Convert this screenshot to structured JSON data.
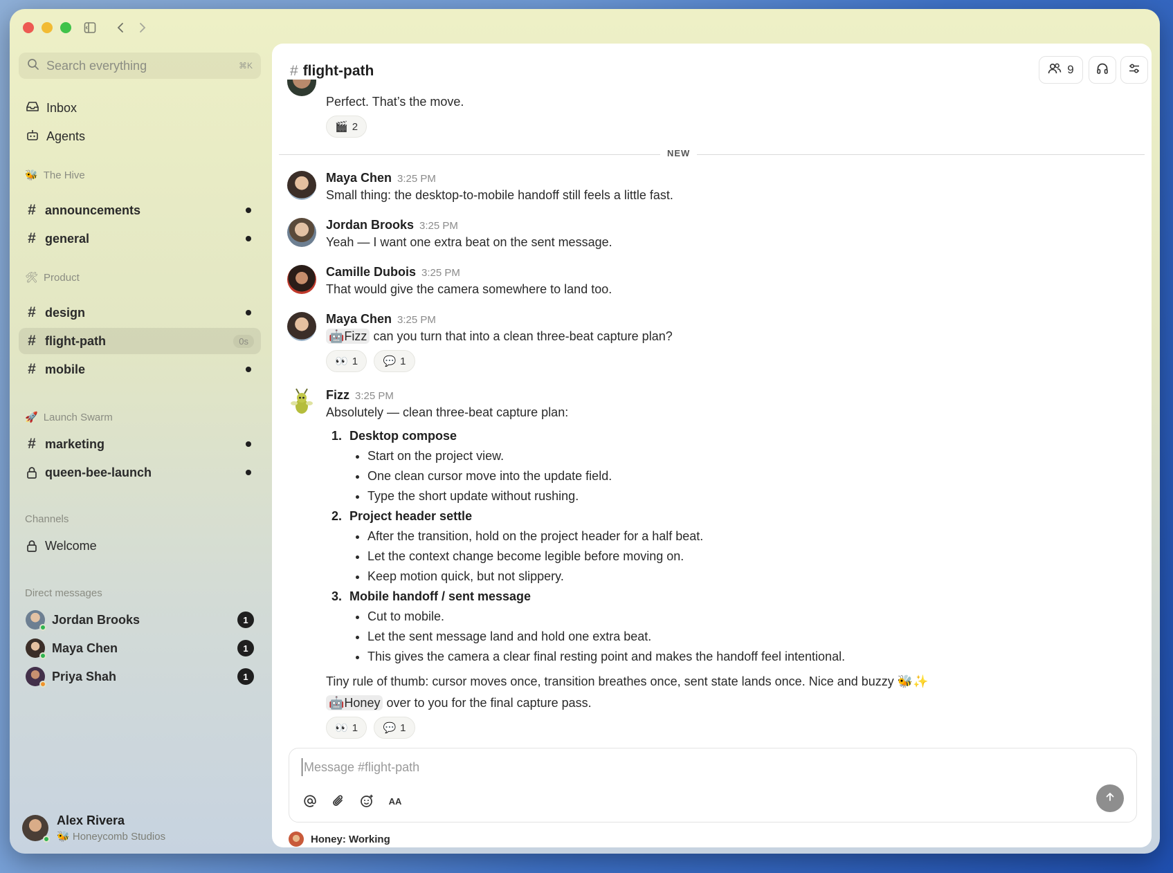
{
  "sidebar": {
    "search_placeholder": "Search everything",
    "search_shortcut": "⌘K",
    "inbox": "Inbox",
    "agents": "Agents",
    "groups": [
      {
        "title": "The Hive",
        "emoji": "🐝",
        "channels": [
          {
            "name": "announcements",
            "unread": true
          },
          {
            "name": "general",
            "unread": true
          }
        ]
      },
      {
        "title": "Product",
        "emoji": "🛠",
        "channels": [
          {
            "name": "design",
            "unread": true
          },
          {
            "name": "flight-path",
            "active": true,
            "time": "0s"
          },
          {
            "name": "mobile",
            "unread": true
          }
        ]
      },
      {
        "title": "Launch Swarm",
        "emoji": "🚀",
        "channels": [
          {
            "name": "marketing",
            "unread": true
          },
          {
            "name": "queen-bee-launch",
            "unread": true,
            "private": true
          }
        ]
      }
    ],
    "channels_title": "Channels",
    "welcome": "Welcome",
    "dm_title": "Direct messages",
    "dms": [
      {
        "name": "Jordan Brooks",
        "count": "1",
        "color": "#7a8a9a"
      },
      {
        "name": "Maya Chen",
        "count": "1",
        "color": "#5a4a40"
      },
      {
        "name": "Priya Shah",
        "count": "1",
        "color": "#6a3a4a"
      }
    ],
    "user": {
      "name": "Alex Rivera",
      "org": "Honeycomb Studios",
      "org_emoji": "🐝"
    }
  },
  "header": {
    "channel": "flight-path",
    "members": "9"
  },
  "messages": {
    "prev_text": "Perfect. That’s the move.",
    "prev_reaction": {
      "emoji": "🎬",
      "count": "2"
    },
    "divider": "NEW",
    "m1": {
      "name": "Maya Chen",
      "time": "3:25 PM",
      "text": "Small thing: the desktop-to-mobile handoff still feels a little fast."
    },
    "m2": {
      "name": "Jordan Brooks",
      "time": "3:25 PM",
      "text": "Yeah — I want one extra beat on the sent message."
    },
    "m3": {
      "name": "Camille Dubois",
      "time": "3:25 PM",
      "text": "That would give the camera somewhere to land too."
    },
    "m4": {
      "name": "Maya Chen",
      "time": "3:25 PM",
      "mention": "Fizz",
      "text": "can you turn that into a clean three-beat capture plan?",
      "r1": {
        "emoji": "👀",
        "count": "1"
      },
      "r2": {
        "emoji": "💬",
        "count": "1"
      }
    },
    "m5": {
      "name": "Fizz",
      "time": "3:25 PM",
      "intro": "Absolutely — clean three-beat capture plan:",
      "steps": [
        {
          "title": "Desktop compose",
          "items": [
            "Start on the project view.",
            "One clean cursor move into the update field.",
            "Type the short update without rushing."
          ]
        },
        {
          "title": "Project header settle",
          "items": [
            "After the transition, hold on the project header for a half beat.",
            "Let the context change become legible before moving on.",
            "Keep motion quick, but not slippery."
          ]
        },
        {
          "title": "Mobile handoff / sent message",
          "items": [
            "Cut to mobile.",
            "Let the sent message land and hold one extra beat.",
            "This gives the camera a clear final resting point and makes the handoff feel intentional."
          ]
        }
      ],
      "rule": "Tiny rule of thumb: cursor moves once, transition breathes once, sent state lands once. Nice and buzzy 🐝✨",
      "mention": "Honey",
      "handoff": "over to you for the final capture pass.",
      "r1": {
        "emoji": "👀",
        "count": "1"
      },
      "r2": {
        "emoji": "💬",
        "count": "1"
      }
    }
  },
  "composer": {
    "placeholder": "Message #flight-path",
    "format_label": "AA"
  },
  "status": {
    "text": "Honey: Working"
  }
}
